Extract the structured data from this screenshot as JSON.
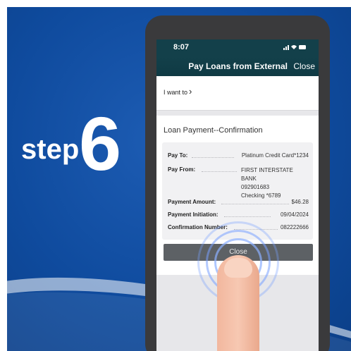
{
  "banner": {
    "step_word": "step",
    "step_number": "6"
  },
  "status_bar": {
    "time": "8:07",
    "icons": "signal wifi battery"
  },
  "nav": {
    "title": "Pay Loans from External",
    "close": "Close"
  },
  "menu": {
    "label": "I want to",
    "chevron": "chevron-right"
  },
  "confirmation": {
    "title": "Loan Payment--Confirmation",
    "pay_to_label": "Pay To:",
    "pay_to_value": "Platinum Credit Card*1234",
    "pay_from_label": "Pay From:",
    "pay_from_bank": "FIRST INTERSTATE BANK",
    "pay_from_routing": "092901683",
    "pay_from_account": "Checking *6789",
    "amount_label": "Payment Amount:",
    "amount_value": "$46.28",
    "initiation_label": "Payment Initiation:",
    "initiation_value": "09/04/2024",
    "confirmation_label": "Confirmation Number:",
    "confirmation_value": "082222666",
    "close_button": "Close"
  },
  "colors": {
    "background": "#0f4b9e",
    "nav": "#13404a",
    "button": "#5d6165"
  }
}
